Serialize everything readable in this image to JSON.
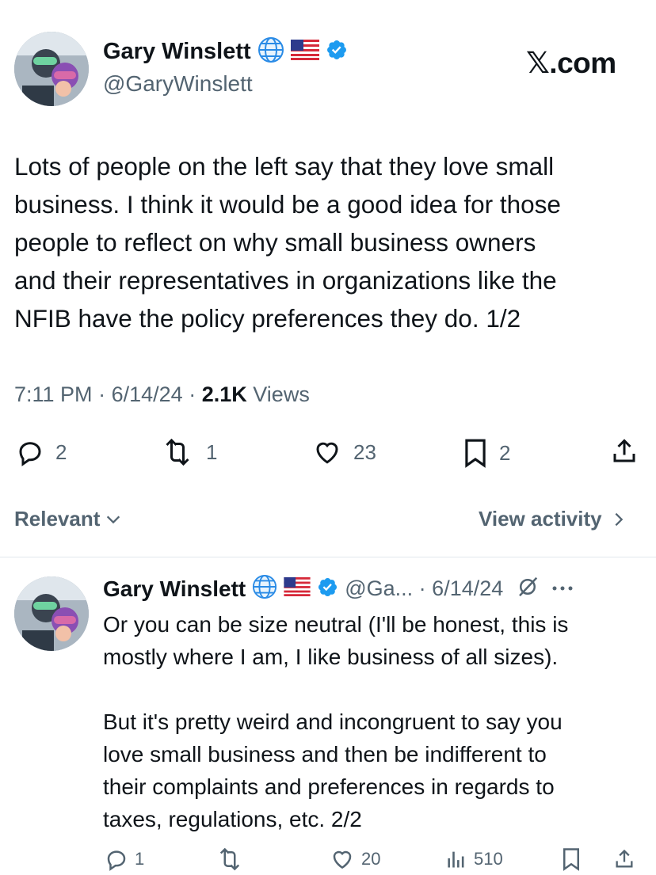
{
  "tweet": {
    "author_name": "Gary Winslett",
    "author_handle": "@GaryWinslett",
    "text": "Lots of people on the left say that they love small\nbusiness. I think it would be a good idea for those\npeople to reflect on why small business owners\nand their representatives in organizations like the\nNFIB have the policy preferences they do. 1/2",
    "time": "7:11 PM",
    "sep": "·",
    "date": "6/14/24",
    "views_count": "2.1K",
    "views_label": "Views",
    "replies": "2",
    "reposts": "1",
    "likes": "23",
    "bookmarks": "2"
  },
  "site_label": "𝕏.com",
  "sort": {
    "label": "Relevant",
    "view_activity": "View activity"
  },
  "reply": {
    "author_name": "Gary Winslett",
    "handle_date": "@Ga... · 6/14/24",
    "text": "Or you can be size neutral (I'll be honest, this is\nmostly where I am, I like business of all sizes).\n\nBut it's pretty weird and incongruent to say you\nlove small business and then be indifferent to\ntheir complaints and preferences in regards to\ntaxes, regulations, etc. 2/2",
    "replies": "1",
    "likes": "20",
    "views": "510"
  },
  "colors": {
    "text": "#0f1419",
    "secondary": "#536471",
    "verified": "#1d9bf0"
  },
  "icons": [
    "globe-emoji",
    "us-flag-emoji",
    "verified-badge-icon",
    "reply-icon",
    "repost-icon",
    "like-icon",
    "bookmark-icon",
    "share-icon",
    "views-icon",
    "grok-icon",
    "more-icon",
    "chevron-down-icon",
    "chevron-right-icon"
  ]
}
